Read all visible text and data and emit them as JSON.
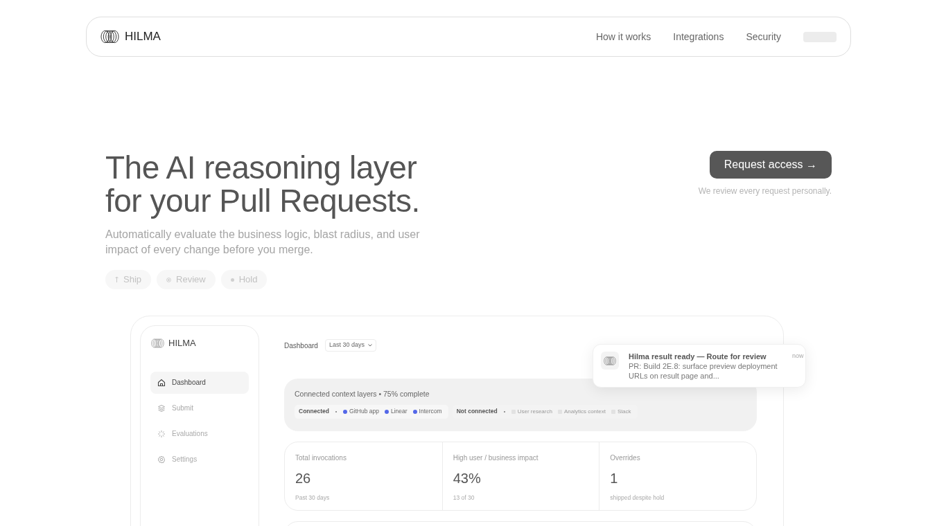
{
  "nav": {
    "brand": "HILMA",
    "links": [
      "How it works",
      "Integrations",
      "Security"
    ]
  },
  "hero": {
    "title_lines": [
      "The AI reasoning layer",
      "for your Pull Requests."
    ],
    "subtitle": "Automatically evaluate the business logic, blast radius, and user impact of every change before you merge.",
    "verdicts": [
      {
        "kind": "ship",
        "label": "Ship"
      },
      {
        "kind": "review",
        "label": "Review"
      },
      {
        "kind": "hold",
        "label": "Hold"
      }
    ],
    "cta": {
      "label": "Request access",
      "arrow": "→",
      "note": "We review every request personally."
    }
  },
  "app": {
    "brand": "HILMA",
    "sidebar": {
      "items": [
        {
          "kind": "home",
          "label": "Dashboard",
          "selected": true
        },
        {
          "kind": "layers",
          "label": "Submit",
          "selected": false
        },
        {
          "kind": "spark",
          "label": "Evaluations",
          "selected": false
        },
        {
          "kind": "gear",
          "label": "Settings",
          "selected": false
        }
      ]
    },
    "header": {
      "title": "Dashboard",
      "range": "Last 30 days"
    },
    "context": {
      "title": "Connected context layers • 75% complete",
      "groups": [
        {
          "label": "Connected",
          "connected": true,
          "items": [
            {
              "label": "GitHub app",
              "color": "#5468e8"
            },
            {
              "label": "Linear",
              "color": "#5468e8"
            },
            {
              "label": "Intercom",
              "color": "#5468e8"
            }
          ]
        },
        {
          "label": "Not connected",
          "connected": false,
          "items": [
            {
              "label": "User research",
              "color": "#e2e2e2"
            },
            {
              "label": "Analytics context",
              "color": "#e2e2e2"
            },
            {
              "label": "Slack",
              "color": "#e2e2e2"
            }
          ]
        }
      ]
    },
    "stats": [
      {
        "label": "Total invocations",
        "value": "26",
        "note": "Past 30 days"
      },
      {
        "label": "High user / business impact",
        "value": "43%",
        "note": "13 of 30"
      },
      {
        "label": "Overrides",
        "value": "1",
        "note": "shipped despite hold"
      }
    ],
    "notification": {
      "title": "Hilma result ready — Route for review",
      "body": "PR: Build 2E.8: surface preview deployment URLs on result page and...",
      "time": "now"
    }
  }
}
